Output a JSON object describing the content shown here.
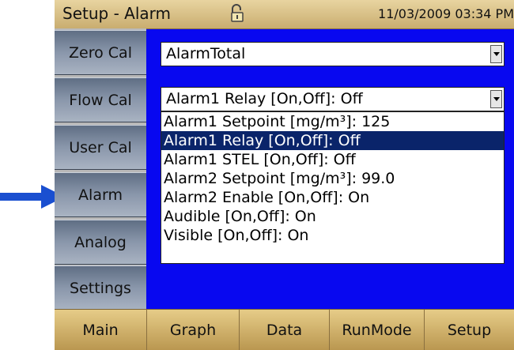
{
  "header": {
    "title": "Setup - Alarm",
    "datetime": "11/03/2009 03:34 PM"
  },
  "icons": {
    "lock": "unlocked-padlock-icon",
    "arrow": "right-arrow-icon"
  },
  "colors": {
    "panel_bg": "#0808f0",
    "selection": "#0a246a",
    "arrow": "#1a4fd0"
  },
  "sidebar": {
    "items": [
      {
        "label": "Zero Cal"
      },
      {
        "label": "Flow Cal"
      },
      {
        "label": "User Cal"
      },
      {
        "label": "Alarm"
      },
      {
        "label": "Analog"
      },
      {
        "label": "Settings"
      }
    ]
  },
  "main": {
    "alarm_select": {
      "value": "AlarmTotal"
    },
    "setting_select": {
      "value": "Alarm1 Relay [On,Off]: Off"
    },
    "options": [
      "Alarm1 Setpoint [mg/m³]: 125",
      "Alarm1 Relay [On,Off]: Off",
      "Alarm1 STEL [On,Off]: Off",
      "Alarm2 Setpoint [mg/m³]: 99.0",
      "Alarm2 Enable [On,Off]: On",
      "Audible [On,Off]: On",
      "Visible [On,Off]: On"
    ],
    "selected_index": 1
  },
  "bottom_nav": {
    "items": [
      {
        "label": "Main"
      },
      {
        "label": "Graph"
      },
      {
        "label": "Data"
      },
      {
        "label": "RunMode"
      },
      {
        "label": "Setup"
      }
    ]
  }
}
